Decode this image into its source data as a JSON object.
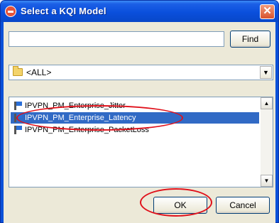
{
  "window": {
    "title": "Select a KQI Model",
    "close_glyph": "✕"
  },
  "search": {
    "value": "",
    "find_label": "Find"
  },
  "filter": {
    "selected": "<ALL>",
    "arrow_glyph": "▼"
  },
  "list": {
    "items": [
      "IPVPN_PM_Enterprise_Jitter",
      "IPVPN_PM_Enterprise_Latency",
      "IPVPN_PM_Enterprise_PacketLoss"
    ],
    "selected_index": 1,
    "scroll_up_glyph": "▲",
    "scroll_down_glyph": "▼"
  },
  "footer": {
    "ok_label": "OK",
    "cancel_label": "Cancel"
  },
  "colors": {
    "title_bar": "#0a4fdc",
    "selection": "#316ac5",
    "annotation": "#e0101a"
  },
  "icons": {
    "app": "kqi-app-icon",
    "folder": "folder-icon",
    "item": "flag-icon"
  }
}
